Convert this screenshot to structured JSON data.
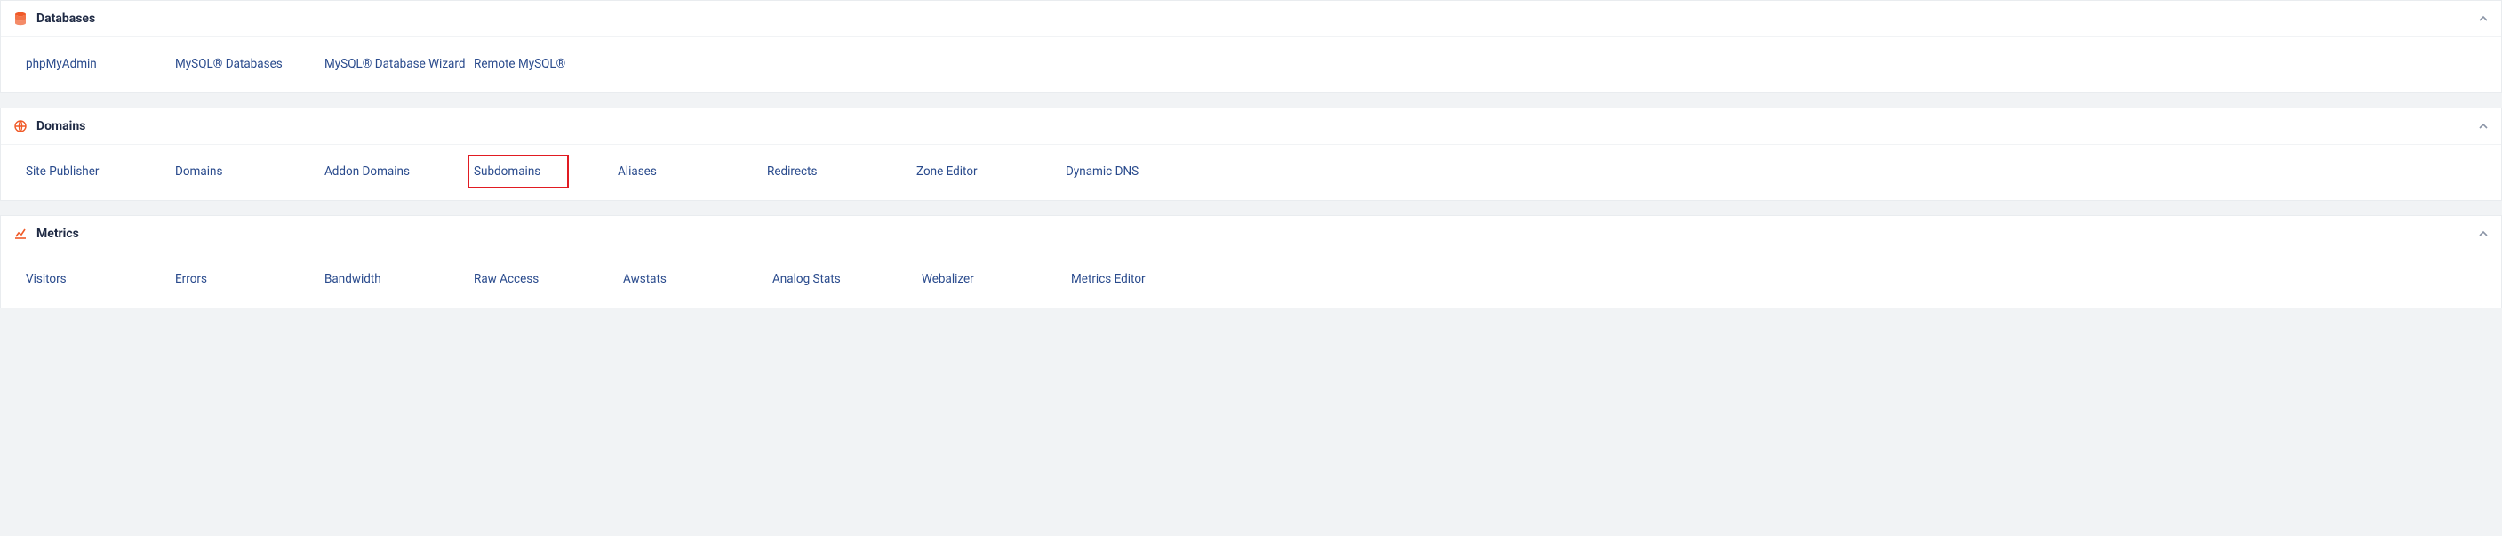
{
  "sections": [
    {
      "id": "databases",
      "title": "Databases",
      "icon": "database-icon",
      "items": [
        {
          "label": "phpMyAdmin"
        },
        {
          "label": "MySQL® Databases"
        },
        {
          "label": "MySQL® Database Wizard"
        },
        {
          "label": "Remote MySQL®"
        }
      ]
    },
    {
      "id": "domains",
      "title": "Domains",
      "icon": "globe-icon",
      "items": [
        {
          "label": "Site Publisher"
        },
        {
          "label": "Domains"
        },
        {
          "label": "Addon Domains"
        },
        {
          "label": "Subdomains",
          "highlight": true
        },
        {
          "label": "Aliases"
        },
        {
          "label": "Redirects"
        },
        {
          "label": "Zone Editor"
        },
        {
          "label": "Dynamic DNS"
        }
      ]
    },
    {
      "id": "metrics",
      "title": "Metrics",
      "icon": "chart-icon",
      "items": [
        {
          "label": "Visitors"
        },
        {
          "label": "Errors"
        },
        {
          "label": "Bandwidth"
        },
        {
          "label": "Raw Access"
        },
        {
          "label": "Awstats"
        },
        {
          "label": "Analog Stats"
        },
        {
          "label": "Webalizer"
        },
        {
          "label": "Metrics Editor"
        }
      ]
    }
  ]
}
